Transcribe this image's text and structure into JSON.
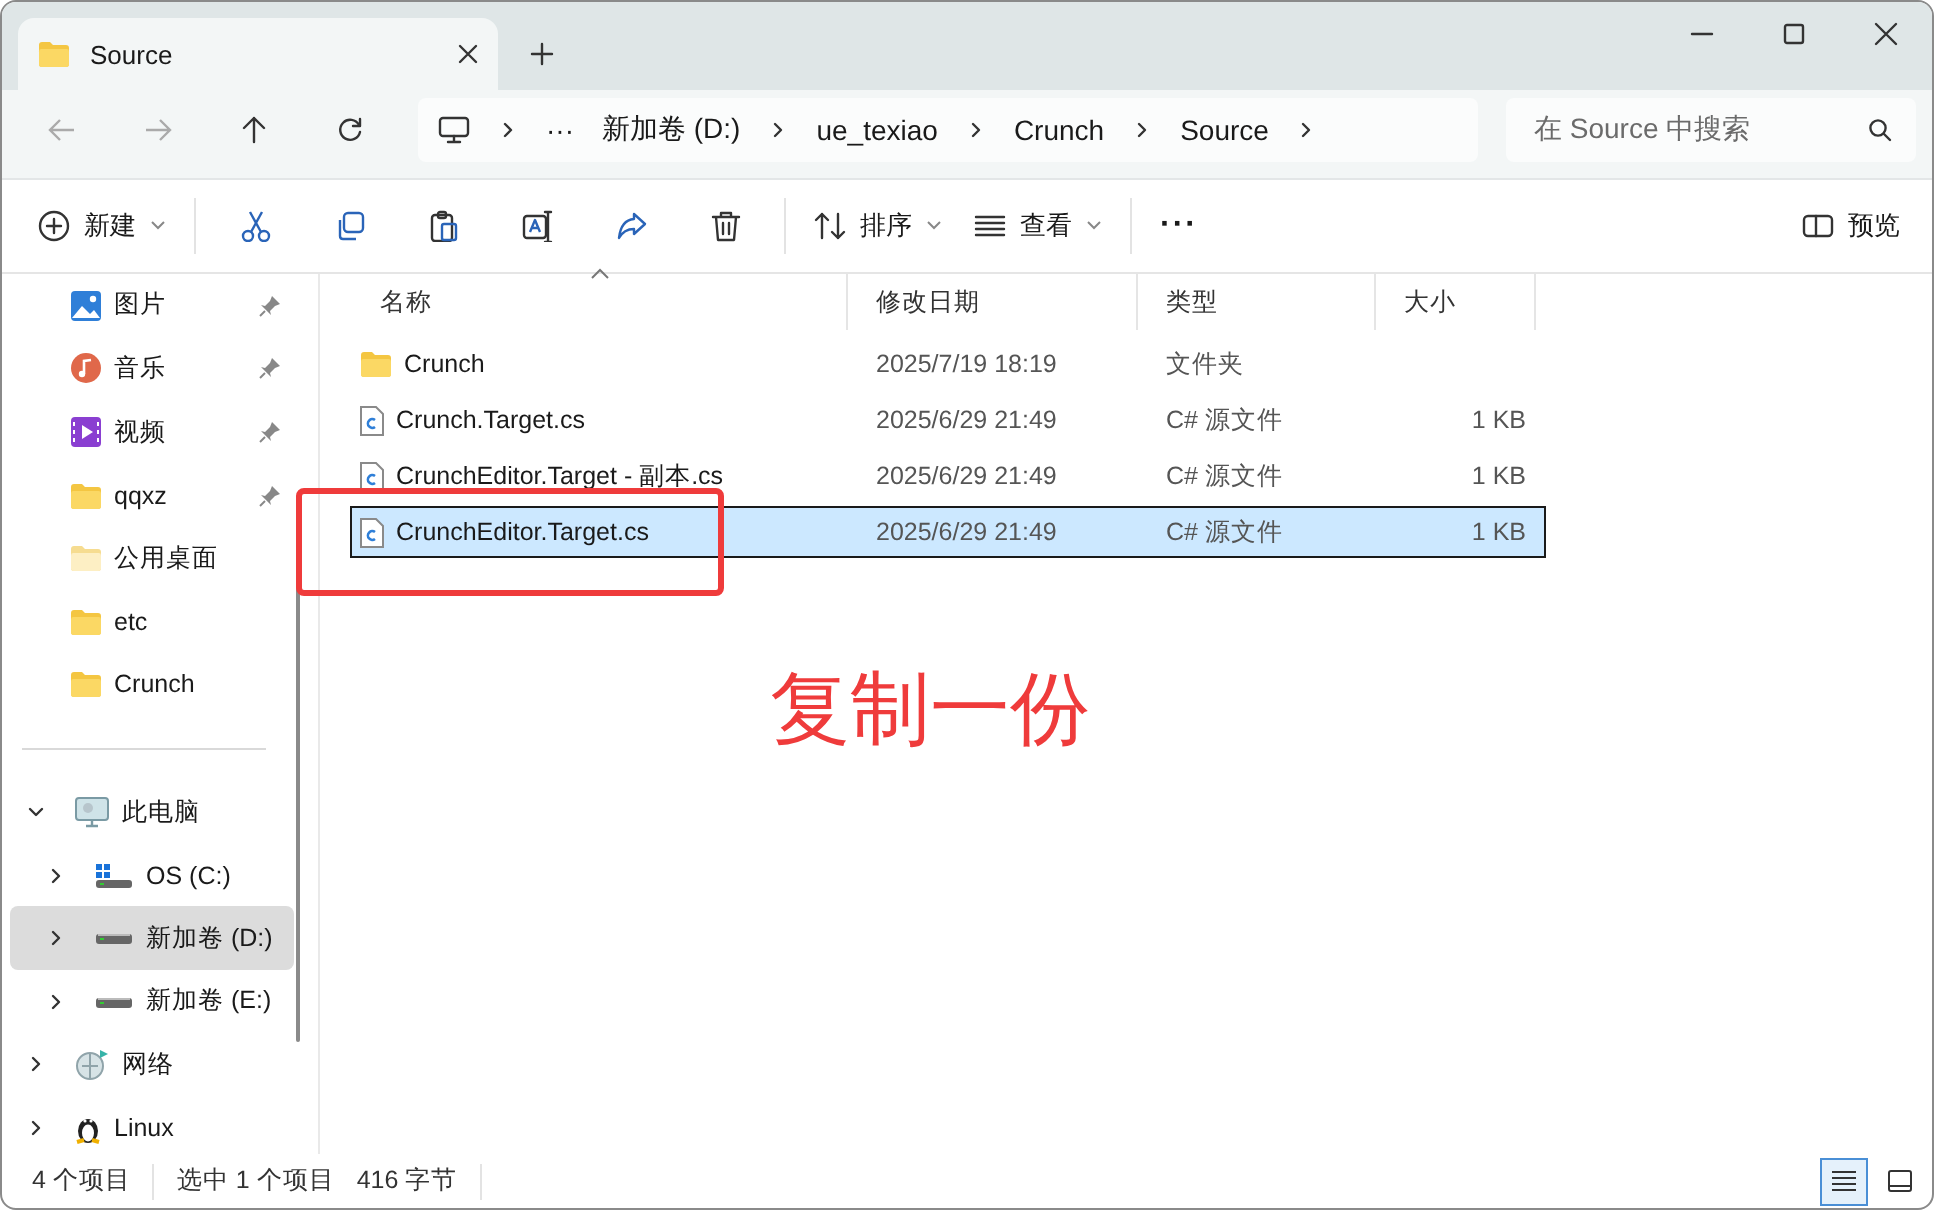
{
  "window": {
    "tab_title": "Source"
  },
  "address": {
    "overflow_label": "···",
    "crumbs": [
      "新加卷 (D:)",
      "ue_texiao",
      "Crunch",
      "Source"
    ],
    "search_placeholder": "在 Source 中搜索"
  },
  "toolbar": {
    "new_label": "新建",
    "sort_label": "排序",
    "view_label": "查看",
    "more_label": "···",
    "preview_label": "预览"
  },
  "sidebar": {
    "quick_access": [
      {
        "label": "图片",
        "kind": "pictures",
        "pinned": true
      },
      {
        "label": "音乐",
        "kind": "music",
        "pinned": true
      },
      {
        "label": "视频",
        "kind": "videos",
        "pinned": true
      },
      {
        "label": "qqxz",
        "kind": "folder",
        "pinned": true
      },
      {
        "label": "公用桌面",
        "kind": "folder-light",
        "pinned": false
      },
      {
        "label": "etc",
        "kind": "folder",
        "pinned": false
      },
      {
        "label": "Crunch",
        "kind": "folder",
        "pinned": false
      }
    ],
    "tree": [
      {
        "label": "此电脑",
        "kind": "pc",
        "expanded": true,
        "selected": false,
        "children": [
          {
            "label": "OS (C:)",
            "kind": "system-drive",
            "expanded": false,
            "selected": false
          },
          {
            "label": "新加卷 (D:)",
            "kind": "drive",
            "expanded": false,
            "selected": true
          },
          {
            "label": "新加卷 (E:)",
            "kind": "drive",
            "expanded": false,
            "selected": false
          }
        ]
      },
      {
        "label": "网络",
        "kind": "network",
        "expanded": false,
        "selected": false
      },
      {
        "label": "Linux",
        "kind": "linux",
        "expanded": false,
        "selected": false
      }
    ]
  },
  "file_list": {
    "columns": [
      {
        "label": "名称",
        "sorted": true
      },
      {
        "label": "修改日期",
        "sorted": false
      },
      {
        "label": "类型",
        "sorted": false
      },
      {
        "label": "大小",
        "sorted": false
      }
    ],
    "rows": [
      {
        "name": "Crunch",
        "modified": "2025/7/19 18:19",
        "type": "文件夹",
        "size": "",
        "kind": "folder",
        "selected": false
      },
      {
        "name": "Crunch.Target.cs",
        "modified": "2025/6/29 21:49",
        "type": "C# 源文件",
        "size": "1 KB",
        "kind": "cs",
        "selected": false
      },
      {
        "name": "CrunchEditor.Target - 副本.cs",
        "modified": "2025/6/29 21:49",
        "type": "C# 源文件",
        "size": "1 KB",
        "kind": "cs",
        "selected": false
      },
      {
        "name": "CrunchEditor.Target.cs",
        "modified": "2025/6/29 21:49",
        "type": "C# 源文件",
        "size": "1 KB",
        "kind": "cs",
        "selected": true
      }
    ]
  },
  "annotation": {
    "text": "复制一份"
  },
  "status_bar": {
    "item_count": "4 个项目",
    "selection": "选中 1 个项目",
    "selection_size": "416 字节",
    "views": [
      {
        "kind": "details",
        "selected": true
      },
      {
        "kind": "tiles",
        "selected": false
      }
    ]
  }
}
